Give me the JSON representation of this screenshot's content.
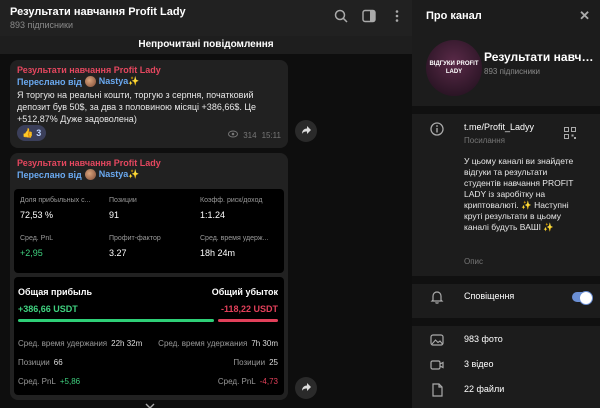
{
  "chat": {
    "title": "Результати навчання Profit Lady",
    "subscribers": "893 підписники",
    "unread_banner": "Непрочитані повідомлення"
  },
  "msg1": {
    "channel": "Результати навчання Profit Lady",
    "forwarded": "Переслано від",
    "author": "Nastya✨",
    "text": "Я торгую на реальні кошти, торгую з серпня, початковий депозит був 50$, за два з половиною місяці +386,66$. Це +512,87% Дуже задоволена)",
    "reaction_emoji": "👍",
    "reaction_count": "3",
    "views": "314",
    "time": "15:11"
  },
  "msg2": {
    "channel": "Результати навчання Profit Lady",
    "forwarded": "Переслано від",
    "author": "Nastya✨",
    "stats": [
      {
        "label": "Доля прибыльных с...",
        "value": "72,53 %"
      },
      {
        "label": "Позиции",
        "value": "91"
      },
      {
        "label": "Коэфф. риск/доход",
        "value": "1:1.24"
      },
      {
        "label": "Сред. PnL",
        "value": "+2,95"
      },
      {
        "label": "Профит-фактор",
        "value": "3.27"
      },
      {
        "label": "Сред. время удерж...",
        "value": "18h 24m"
      }
    ],
    "profit_label": "Общая прибыль",
    "profit_value": "+386,66 USDT",
    "loss_label": "Общий убыток",
    "loss_value": "-118,22 USDT",
    "profit_hold_label": "Сред. время удержания",
    "profit_hold_value": "22h 32m",
    "loss_hold_label": "Сред. время удержания",
    "loss_hold_value": "7h 30m",
    "profit_pos_label": "Позиции",
    "profit_pos_value": "66",
    "loss_pos_label": "Позиции",
    "loss_pos_value": "25",
    "profit_pnl_label": "Сред. PnL",
    "profit_pnl_value": "+5,86",
    "loss_pnl_label": "Сред. PnL",
    "loss_pnl_value": "-4,73"
  },
  "panel": {
    "title": "Про канал",
    "avatar_text": "ВІДГУКИ PROFIT LADY",
    "name": "Результати навчан...",
    "subscribers": "893 підписники",
    "link": "t.me/Profit_Ladyy",
    "link_sub": "Посилання",
    "description": "У цьому каналі ви знайдете відгуки та результати студентів навчання PROFIT LADY із заробітку на криптовалюті. ✨ Наступні круті результати в цьому каналі будуть ВАШІ ✨",
    "description_sub": "Опис",
    "notifications": "Сповіщення",
    "photos": "983 фото",
    "videos": "3 відео",
    "files": "22 файли"
  },
  "colors": {
    "accent_red": "#e5475f",
    "accent_blue": "#6aa9f0",
    "profit_green": "#2ecf77",
    "loss_red": "#e2405a"
  },
  "icons": [
    "search-icon",
    "sidebar-icon",
    "more-icon",
    "share-icon",
    "eye-icon",
    "close-icon",
    "info-icon",
    "qr-icon",
    "bell-icon",
    "photo-icon",
    "video-icon",
    "file-icon"
  ]
}
